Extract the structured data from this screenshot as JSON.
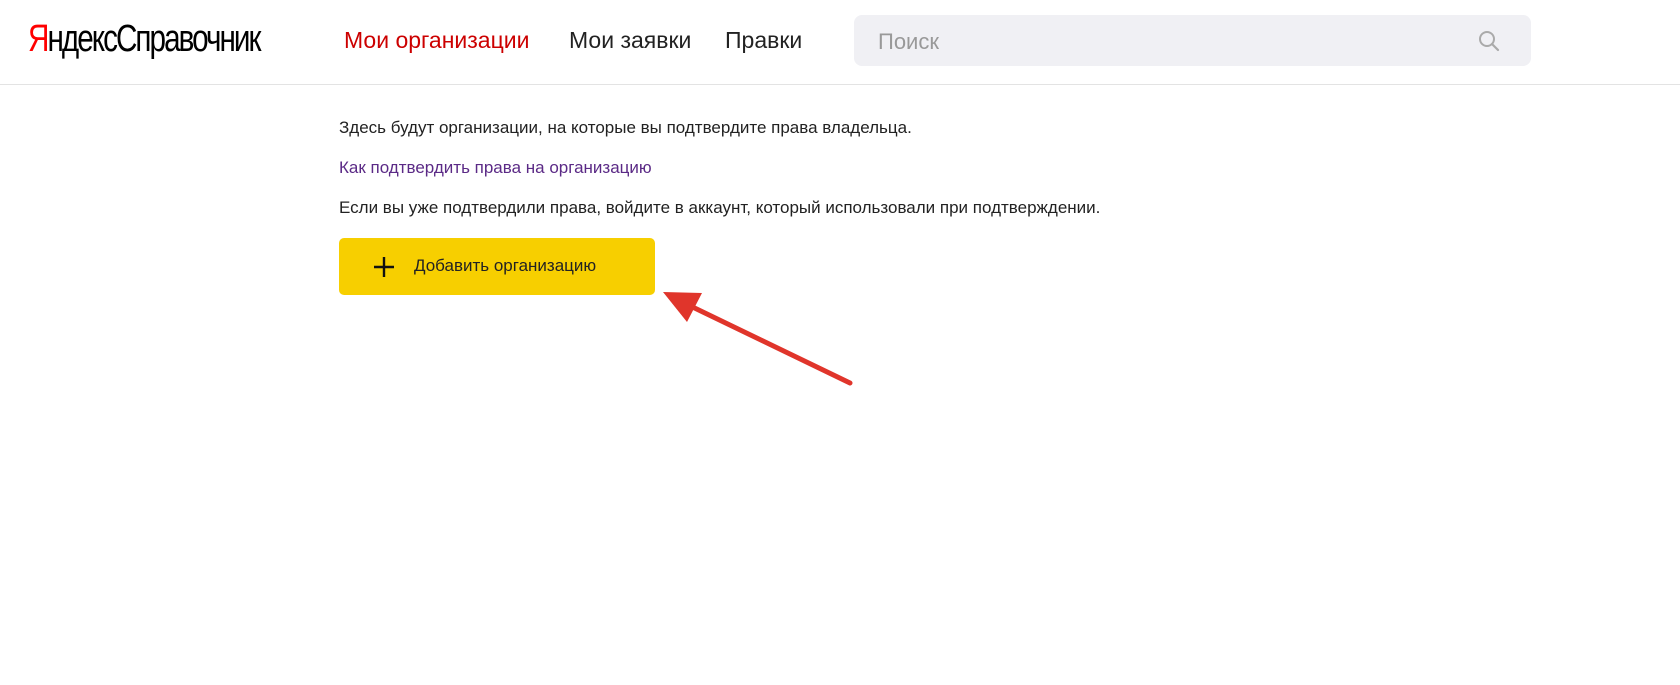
{
  "header": {
    "logo_yandex": "Яндекс",
    "logo_product": "Справочник",
    "nav": [
      {
        "label": "Мои организации",
        "active": true
      },
      {
        "label": "Мои заявки",
        "active": false
      },
      {
        "label": "Правки",
        "active": false
      }
    ],
    "search": {
      "placeholder": "Поиск",
      "value": "",
      "icon": "search-icon"
    }
  },
  "main": {
    "info_text": "Здесь будут организации, на которые вы подтвердите права владельца.",
    "help_link": "Как подтвердить права на организацию",
    "hint_text": "Если вы уже подтвердили права, войдите в аккаунт, который использовали при подтверждении.",
    "add_button": {
      "label": "Добавить организацию",
      "icon": "plus-icon"
    }
  },
  "colors": {
    "accent_nav": "#cc0000",
    "button": "#f7cf00",
    "link": "#5b2a86",
    "annotation_arrow": "#e0352b"
  }
}
